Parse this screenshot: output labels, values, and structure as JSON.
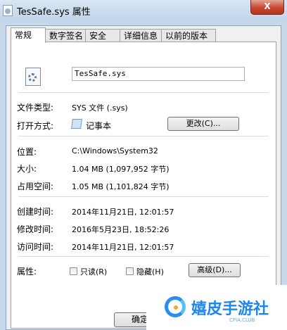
{
  "window": {
    "title": "TesSafe.sys 属性",
    "close_glyph": "X"
  },
  "tabs": [
    {
      "label": "常规",
      "active": true
    },
    {
      "label": "数字签名"
    },
    {
      "label": "安全"
    },
    {
      "label": "详细信息"
    },
    {
      "label": "以前的版本"
    }
  ],
  "general": {
    "file_name": "TesSafe.sys",
    "file_type": {
      "label": "文件类型:",
      "value": "SYS 文件 (.sys)"
    },
    "opens_with": {
      "label": "打开方式:",
      "value": "记事本",
      "button": "更改(C)..."
    },
    "location": {
      "label": "位置:",
      "value": "C:\\Windows\\System32"
    },
    "size": {
      "label": "大小:",
      "value": "1.04 MB (1,097,952 字节)"
    },
    "size_on_disk": {
      "label": "占用空间:",
      "value": "1.05 MB (1,101,824 字节)"
    },
    "created": {
      "label": "创建时间:",
      "value": "2014年11月21日, 12:01:57"
    },
    "modified": {
      "label": "修改时间:",
      "value": "2016年5月23日, 18:52:26"
    },
    "accessed": {
      "label": "访问时间:",
      "value": "2014年11月21日, 12:01:57"
    },
    "attributes": {
      "label": "属性:",
      "readonly": {
        "label": "只读(R)",
        "checked": false
      },
      "hidden": {
        "label": "隐藏(H)",
        "checked": false
      },
      "advanced_button": "高级(D)..."
    }
  },
  "footer": {
    "ok_label": "确定"
  },
  "watermark": {
    "text": "嬉皮手游社",
    "sub": "CPIA.CLUB"
  },
  "colors": {
    "accent": "#1f86ee",
    "close": "#c8452f"
  }
}
